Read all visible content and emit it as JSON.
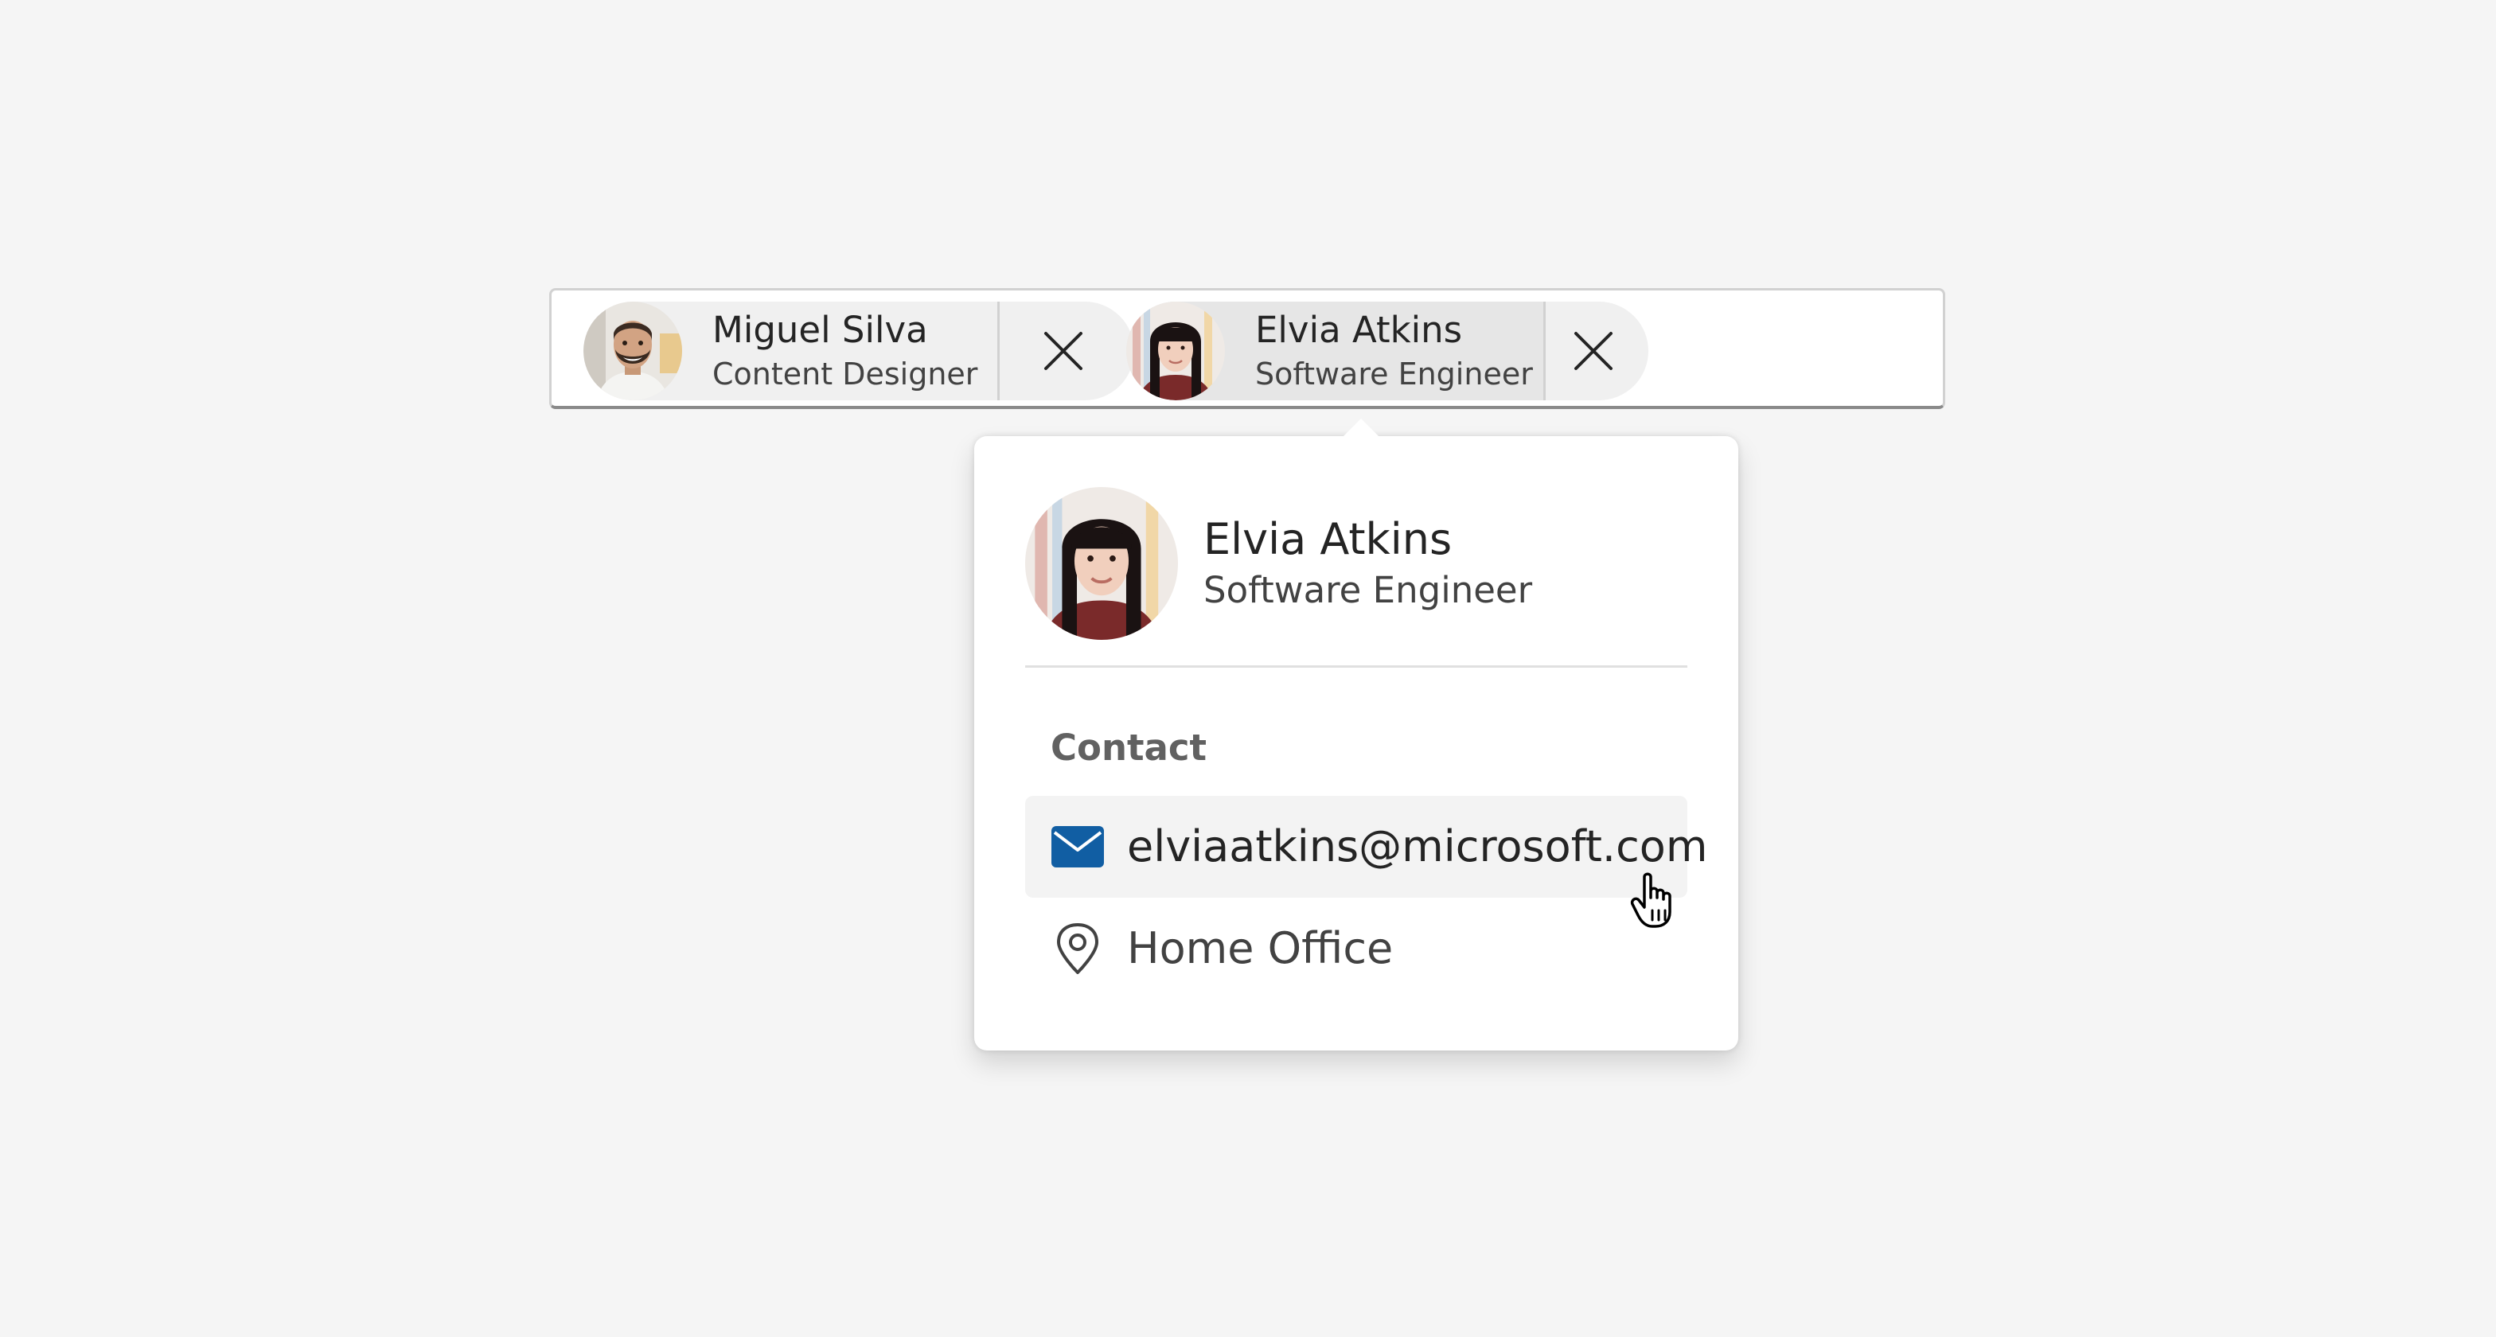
{
  "picker": {
    "selected": [
      {
        "name": "Miguel Silva",
        "role": "Content Designer",
        "avatar_icon": "person-photo-miguel",
        "remove_icon": "close-icon"
      },
      {
        "name": "Elvia Atkins",
        "role": "Software Engineer",
        "avatar_icon": "person-photo-elvia",
        "remove_icon": "close-icon"
      }
    ]
  },
  "card": {
    "name": "Elvia Atkins",
    "role": "Software Engineer",
    "contact_title": "Contact",
    "email": "elviaatkins@microsoft.com",
    "location": "Home Office",
    "email_icon": "mail-icon",
    "location_icon": "location-pin-icon"
  },
  "colors": {
    "background": "#f5f5f5",
    "mail_icon": "#115ea3",
    "chip_background": "#f0f0f0",
    "chip_active_background": "#e6e6e6"
  },
  "cursor": {
    "icon": "hand-pointer-cursor"
  }
}
